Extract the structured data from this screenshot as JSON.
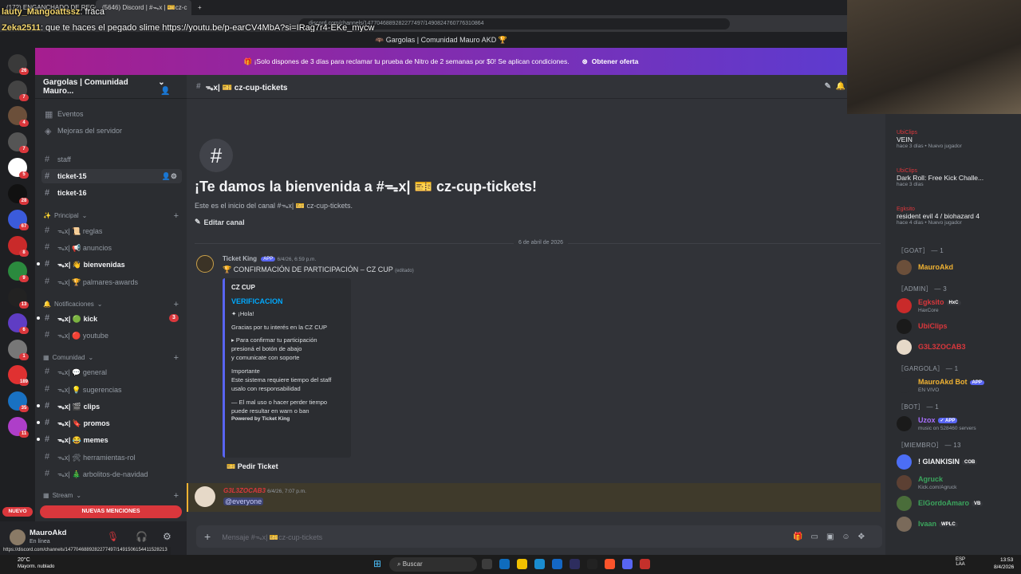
{
  "browser": {
    "tabs": [
      "(172) ENGANCHADO DE REGGA",
      "(5646) Discord | #ᯓx | 🎫cz-c"
    ],
    "url": "discord.com/channels/1477046889282277497/1490824760776310864"
  },
  "stream_chat": [
    {
      "user": "lauty_Mangoattssz",
      "text": ": fraca"
    },
    {
      "user": "Zeka2511",
      "text": ": que te haces el pegado slime https://youtu.be/p-earCV4MbA?si=IRag7r4-EKe_mycw"
    }
  ],
  "window": {
    "title": "🦇 Gargolas | Comunidad Mauro AKD 🏆"
  },
  "nitro": {
    "text": "🎁 ¡Solo dispones de 3 días para reclamar tu prueba de Nitro de 2 semanas por $0! Se aplican condiciones.",
    "button": "Obtener oferta"
  },
  "server_badges": [
    "26",
    "7",
    "4",
    "7",
    "5",
    "28",
    "67",
    "8",
    "9",
    "13",
    "6",
    "1",
    "189",
    "35",
    "11"
  ],
  "sidebar": {
    "server_name": "Gargolas | Comunidad Mauro...",
    "top": [
      {
        "label": "Eventos"
      },
      {
        "label": "Mejoras del servidor"
      }
    ],
    "tickets": [
      "staff",
      "ticket-15",
      "ticket-16"
    ],
    "categories": [
      {
        "name": "Principal",
        "channels": [
          {
            "label": "ᯓx| 📜 reglas",
            "unread": false
          },
          {
            "label": "ᯓx| 📢 anuncios",
            "unread": false
          },
          {
            "label": "ᯓx| 👋 bienvenidas",
            "unread": true
          },
          {
            "label": "ᯓx| 🏆 palmares-awards",
            "unread": false
          }
        ]
      },
      {
        "name": "Notificaciones",
        "channels": [
          {
            "label": "ᯓx| 🟢 kick",
            "unread": true,
            "mentions": "3"
          },
          {
            "label": "ᯓx| 🔴 youtube",
            "unread": false
          }
        ]
      },
      {
        "name": "Comunidad",
        "channels": [
          {
            "label": "ᯓx| 💬 general",
            "unread": false
          },
          {
            "label": "ᯓx| 💡 sugerencias",
            "unread": false
          },
          {
            "label": "ᯓx| 🎬 clips",
            "unread": true
          },
          {
            "label": "ᯓx| 🔖 promos",
            "unread": true
          },
          {
            "label": "ᯓx| 😂 memes",
            "unread": true
          },
          {
            "label": "ᯓx| 🛠 herramientas-rol",
            "unread": false
          },
          {
            "label": "ᯓx| 🎄 arbolitos-de-navidad",
            "unread": false
          }
        ]
      },
      {
        "name": "Stream",
        "channels": []
      }
    ],
    "new_mentions": "NUEVAS MENCIONES",
    "nuevo": "NUEVO"
  },
  "user": {
    "name": "MauroAkd",
    "status": "En línea"
  },
  "channel": {
    "name": "ᯓx| 🎫 cz-cup-tickets",
    "welcome_title": "¡Te damos la bienvenida a #ᯓx| 🎫 cz-cup-tickets!",
    "welcome_sub": "Este es el inicio del canal #ᯓx| 🎫 cz-cup-tickets.",
    "edit": "Editar canal",
    "date": "6 de abril de 2026",
    "msg1": {
      "author": "Ticket King",
      "badge": "APP",
      "time": "6/4/26, 6:59 p.m.",
      "text": "🏆 CONFIRMACIÓN DE PARTICIPACIÓN – CZ CUP",
      "edited": "(editado)"
    },
    "embed": {
      "author": "CZ CUP",
      "title": "VERIFICACION",
      "lines": [
        "✦ ¡Hola!",
        "",
        "Gracias por tu interés en la CZ CUP",
        "",
        "▸ Para confirmar tu participación",
        "presioná el botón de abajo",
        "y comunicate con soporte",
        "",
        "Importante",
        "Este sistema requiere tiempo del staff",
        "usalo con responsabilidad",
        "",
        "— El mal uso o hacer perder tiempo",
        "puede resultar en warn o ban"
      ],
      "footer": "Powered by Ticket King"
    },
    "button": "🎫 Pedir Ticket",
    "msg2": {
      "author": "G3L3ZOCAB3",
      "time": "6/4/26, 7:07 p.m.",
      "text": "@everyone"
    },
    "input_placeholder": "Mensaje #ᯓx| 🎫cz-cup-tickets"
  },
  "members": {
    "activities": [
      {
        "app": "UbiClips",
        "game": "VEIN",
        "sub": "hace 3 días  •  Nuevo jugador"
      },
      {
        "app": "UbiClips",
        "game": "Dark Roll: Free Kick Challe...",
        "sub": "hace 3 días"
      },
      {
        "app": "Egksito",
        "game": "resident evil 4 / biohazard 4",
        "sub": "hace 4 días  •  Nuevo jugador"
      }
    ],
    "groups": [
      {
        "label": "［GOAT］ — 1",
        "items": [
          {
            "name": "MauroAkd",
            "color": "#f0b232"
          }
        ]
      },
      {
        "label": "［ADMIN］ — 3",
        "items": [
          {
            "name": "Egksito",
            "color": "#da373c",
            "tag": "HxC",
            "status": "HaxCore"
          },
          {
            "name": "UbiClips",
            "color": "#da373c"
          },
          {
            "name": "G3L3ZOCAB3",
            "color": "#da373c"
          }
        ]
      },
      {
        "label": "［GARGOLA］ — 1",
        "items": [
          {
            "name": "MauroAkd Bot",
            "color": "#f0b232",
            "tag": "APP",
            "status": "EN VIVO"
          }
        ]
      },
      {
        "label": "［BOT］ — 1",
        "items": [
          {
            "name": "Uzox",
            "color": "#a970ff",
            "tag": "✓ APP",
            "status": "music on 528460 servers"
          }
        ]
      },
      {
        "label": "［MIEMBRO］ — 13",
        "items": [
          {
            "name": "! GIANKISIN",
            "color": "#f2f3f5",
            "tag": "COB"
          },
          {
            "name": "Agruck",
            "color": "#3ba55d",
            "status": "Kick.com/Agruck"
          },
          {
            "name": "ElGordoAmaro",
            "color": "#3ba55d",
            "tag": "VB"
          },
          {
            "name": "Ivaan",
            "color": "#3ba55d",
            "tag": "WPLC"
          }
        ]
      }
    ]
  },
  "taskbar": {
    "weather_temp": "20°C",
    "weather_text": "Mayorm. nublado",
    "search": "Buscar",
    "lang": "ESP\nLAA",
    "time": "13:53",
    "date": "8/4/2026"
  },
  "status_url": "https://discord.com/channels/1477046889282277497/1491506154411528213"
}
